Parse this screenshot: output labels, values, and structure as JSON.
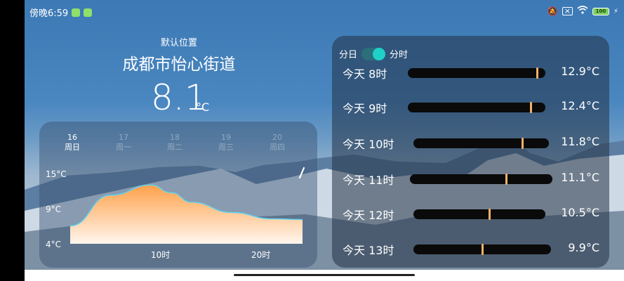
{
  "status_bar": {
    "time": "傍晚6:59",
    "battery": "100"
  },
  "location": {
    "subtitle": "默认位置",
    "name": "成都市怡心街道"
  },
  "current": {
    "temp": "8.1",
    "unit": "°C"
  },
  "forecast": {
    "days": [
      {
        "date": "16",
        "weekday": "周日",
        "active": true
      },
      {
        "date": "17",
        "weekday": "周一",
        "active": false
      },
      {
        "date": "18",
        "weekday": "周二",
        "active": false
      },
      {
        "date": "19",
        "weekday": "周三",
        "active": false
      },
      {
        "date": "20",
        "weekday": "周四",
        "active": false
      }
    ],
    "edit_icon": "slash-icon"
  },
  "chart_data": {
    "type": "area",
    "y_tick_labels": [
      "15°C",
      "9°C",
      "4°C"
    ],
    "x_tick_labels": [
      "10时",
      "20时"
    ],
    "ylim": [
      4,
      15
    ],
    "x": [
      0,
      4,
      8,
      10,
      12,
      16,
      20,
      23
    ],
    "values": [
      6.8,
      11.6,
      13.2,
      12.0,
      10.5,
      8.9,
      7.9,
      7.8
    ],
    "fill_colors": [
      "#ffa14a",
      "#fff6ee"
    ],
    "line_color": "#5fd3f0"
  },
  "hourly": {
    "toggle_left": "分日",
    "toggle_right": "分时",
    "toggle_on": true,
    "rows": [
      {
        "label": "今天 8时",
        "value": "12.9°C",
        "level": 0.95
      },
      {
        "label": "今天 9时",
        "value": "12.4°C",
        "level": 0.9
      },
      {
        "label": "今天 10时",
        "value": "11.8°C",
        "level": 0.81
      },
      {
        "label": "今天 11时",
        "value": "11.1°C",
        "level": 0.68
      },
      {
        "label": "今天 12时",
        "value": "10.5°C",
        "level": 0.58
      },
      {
        "label": "今天 13时",
        "value": "9.9°C",
        "level": 0.5
      }
    ]
  }
}
